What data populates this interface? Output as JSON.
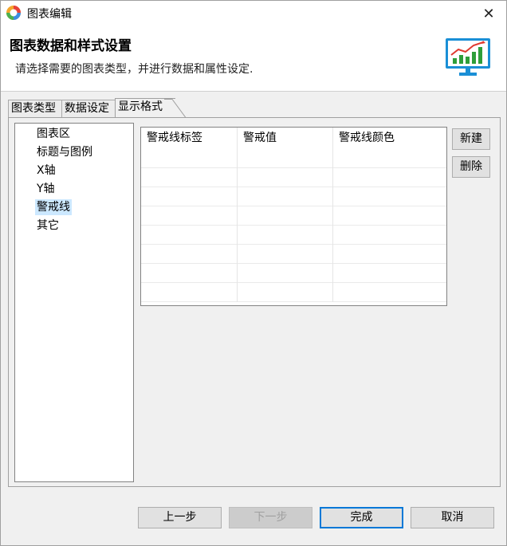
{
  "window": {
    "title": "图表编辑",
    "close_glyph": "✕"
  },
  "banner": {
    "title": "图表数据和样式设置",
    "description": "请选择需要的图表类型，并进行数据和属性设定.",
    "icon": "chart-monitor-icon"
  },
  "tabs": [
    {
      "label": "图表类型",
      "active": false
    },
    {
      "label": "数据设定",
      "active": false
    },
    {
      "label": "显示格式",
      "active": true
    }
  ],
  "tree": {
    "items": [
      {
        "label": "图表区",
        "selected": false
      },
      {
        "label": "标题与图例",
        "selected": false
      },
      {
        "label": "X轴",
        "selected": false
      },
      {
        "label": "Y轴",
        "selected": false
      },
      {
        "label": "警戒线",
        "selected": true
      },
      {
        "label": "其它",
        "selected": false
      }
    ]
  },
  "table": {
    "columns": [
      "警戒线标签",
      "警戒值",
      "警戒线颜色"
    ],
    "rows": []
  },
  "side_buttons": {
    "new": "新建",
    "delete": "删除"
  },
  "footer": {
    "prev": "上一步",
    "next": "下一步",
    "finish": "完成",
    "cancel": "取消"
  },
  "colors": {
    "accent": "#0078d7",
    "selection": "#cce8ff",
    "icon_green": "#2e9e3a",
    "icon_red": "#e03a2f",
    "icon_blue": "#1a8fd6"
  }
}
